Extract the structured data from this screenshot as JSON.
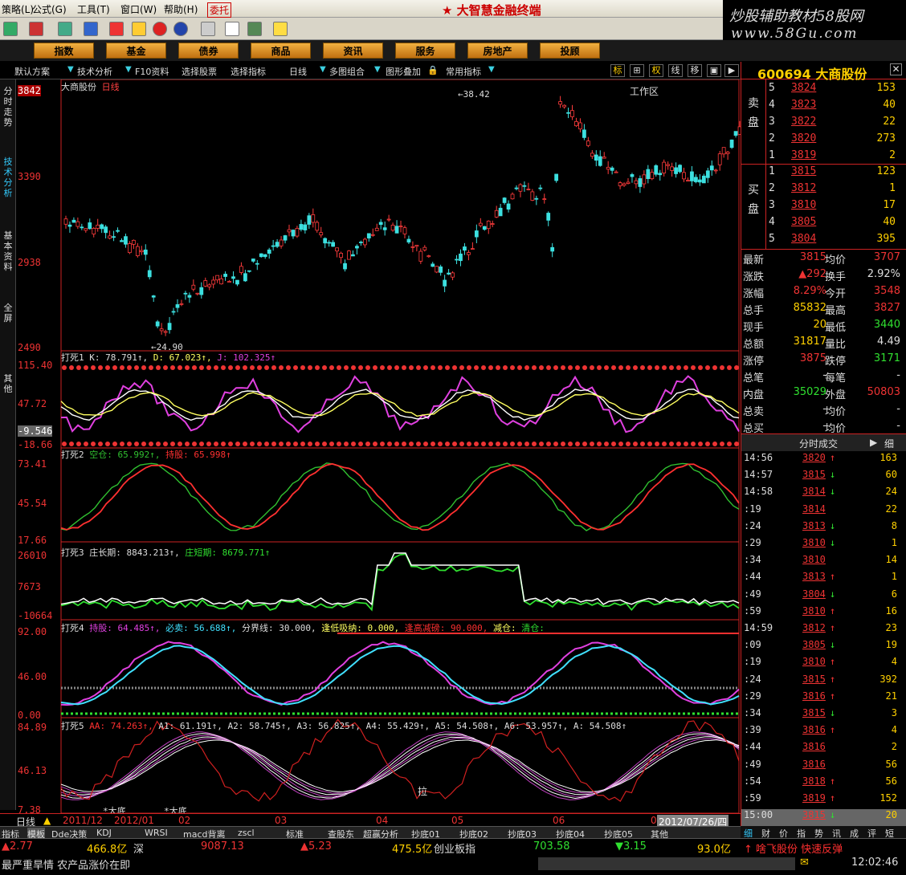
{
  "menu": {
    "items": [
      "策略(L)",
      "公式(G)",
      "工具(T)",
      "窗口(W)",
      "帮助(H)",
      "委托"
    ],
    "app_title": "大智慧金融终端"
  },
  "watermark": {
    "line1": "炒股辅助教材58股网",
    "line2": "www.58Gu.com"
  },
  "nav": {
    "buttons": [
      "指数",
      "基金",
      "债券",
      "商品",
      "资讯",
      "服务",
      "房地产",
      "投顾"
    ],
    "workarea": "工作区"
  },
  "subtoolbar": {
    "items": [
      "默认方案",
      "技术分析",
      "F10资料",
      "选择股票",
      "选择指标",
      "日线",
      "多图组合",
      "图形叠加",
      "常用指标"
    ],
    "right_buttons": [
      "标",
      "⊞",
      "权",
      "线",
      "移",
      "▣",
      "▶"
    ]
  },
  "left_tabs": [
    "分时走势",
    "技术分析",
    "基本资料",
    "全屏",
    "其他"
  ],
  "chart": {
    "title": "大商股份",
    "period": "日线",
    "high_label": "38.42",
    "low_label": "24.90",
    "axis_main": [
      "3842",
      "3390",
      "2938",
      "2490"
    ]
  },
  "panels": [
    {
      "id": "打死1",
      "axis": [
        "115.40",
        "47.72",
        "-9.546",
        "-18.66"
      ],
      "header": [
        {
          "t": "打死1 ",
          "c": "#ddd"
        },
        {
          "t": "K: 78.791↑,",
          "c": "#ddd"
        },
        {
          "t": " D: 67.023↑,",
          "c": "#ffff60"
        },
        {
          "t": " J: 102.325↑",
          "c": "#e040e0"
        }
      ]
    },
    {
      "id": "打死2",
      "axis": [
        "73.41",
        "45.54",
        "17.66"
      ],
      "header": [
        {
          "t": "打死2 ",
          "c": "#ddd"
        },
        {
          "t": "空仓: 65.992↑,",
          "c": "#30c030"
        },
        {
          "t": " 持股: 65.998↑",
          "c": "#ff3030"
        }
      ]
    },
    {
      "id": "打死3",
      "axis": [
        "26010",
        "7673",
        "-10664"
      ],
      "header": [
        {
          "t": "打死3 ",
          "c": "#ddd"
        },
        {
          "t": "庄长期: 8843.213↑,",
          "c": "#ddd"
        },
        {
          "t": " 庄短期: 8679.771↑",
          "c": "#30e030"
        }
      ]
    },
    {
      "id": "打死4",
      "axis": [
        "92.00",
        "46.00",
        "0.00"
      ],
      "header": [
        {
          "t": "打死4 ",
          "c": "#ddd"
        },
        {
          "t": "持股: 64.485↑,",
          "c": "#e040e0"
        },
        {
          "t": " 必卖: 56.688↑,",
          "c": "#40e0ff"
        },
        {
          "t": " 分界线: 30.000,",
          "c": "#ddd"
        },
        {
          "t": " 逢低吸纳: 0.000,",
          "c": "#ffff60"
        },
        {
          "t": " 逢高减磅: 90.000,",
          "c": "#ff3030"
        },
        {
          "t": " 减仓:",
          "c": "#ffff60"
        },
        {
          "t": " 清仓:",
          "c": "#30e030"
        }
      ]
    },
    {
      "id": "打死5",
      "axis": [
        "84.89",
        "46.13",
        "7.38"
      ],
      "header": [
        {
          "t": "打死5 ",
          "c": "#ddd"
        },
        {
          "t": "AA: 74.263↑,",
          "c": "#ff3030"
        },
        {
          "t": " A1: 61.191↑,",
          "c": "#ddd"
        },
        {
          "t": " A2: 58.745↑,",
          "c": "#ddd"
        },
        {
          "t": " A3: 56.825↑,",
          "c": "#ddd"
        },
        {
          "t": " A4: 55.429↑,",
          "c": "#ddd"
        },
        {
          "t": " A5: 54.508↑,",
          "c": "#ddd"
        },
        {
          "t": " A6: 53.957↑,",
          "c": "#ddd"
        },
        {
          "t": " A: 54.508↑",
          "c": "#ddd"
        }
      ]
    }
  ],
  "xaxis": {
    "period_label": "日线",
    "labels": [
      "2011/12",
      "2012/01",
      "02",
      "03",
      "04",
      "05",
      "06",
      "07"
    ],
    "date_box": "2012/07/26/四"
  },
  "tabs": [
    "指标",
    "模板",
    "Dde决策",
    "KDJ",
    "WRSI",
    "macd背离",
    "zscl",
    "标准",
    "查股东",
    "超赢分析",
    "抄底01",
    "抄底02",
    "抄底03",
    "抄底04",
    "抄底05",
    "其他"
  ],
  "pattern_text": {
    "pull": "拉",
    "bottom1": "*大底",
    "bottom2": "*大底"
  },
  "status": {
    "row1": [
      {
        "t": "▲2.77",
        "c": "#e33"
      },
      {
        "t": "466.8亿",
        "c": "#ffd000"
      },
      {
        "t": "深",
        "c": "#ddd"
      },
      {
        "t": "9087.13",
        "c": "#e33"
      },
      {
        "t": "▲5.23",
        "c": "#e33"
      },
      {
        "t": "475.5亿",
        "c": "#ffd000"
      },
      {
        "t": "创业板指",
        "c": "#ddd"
      },
      {
        "t": "703.58",
        "c": "#30e030"
      },
      {
        "t": "▼3.15",
        "c": "#30e030"
      },
      {
        "t": "93.0亿",
        "c": "#ffd000"
      },
      {
        "t": "↑ 啥飞股份 快速反弹",
        "c": "#ff3030"
      }
    ],
    "news": "最严重旱情 农产品涨价在即",
    "time": "12:02:46"
  },
  "stock": {
    "code": "600694",
    "name": "大商股份"
  },
  "orderbook": {
    "sell_label": "卖盘",
    "buy_label": "买盘",
    "sells": [
      {
        "l": "5",
        "p": "3824",
        "v": "153"
      },
      {
        "l": "4",
        "p": "3823",
        "v": "40"
      },
      {
        "l": "3",
        "p": "3822",
        "v": "22"
      },
      {
        "l": "2",
        "p": "3820",
        "v": "273"
      },
      {
        "l": "1",
        "p": "3819",
        "v": "2"
      }
    ],
    "buys": [
      {
        "l": "1",
        "p": "3815",
        "v": "123"
      },
      {
        "l": "2",
        "p": "3812",
        "v": "1"
      },
      {
        "l": "3",
        "p": "3810",
        "v": "17"
      },
      {
        "l": "4",
        "p": "3805",
        "v": "40"
      },
      {
        "l": "5",
        "p": "3804",
        "v": "395"
      }
    ]
  },
  "quote": [
    {
      "a": "最新",
      "av": "3815",
      "ac": "#e33",
      "b": "均价",
      "bv": "3707",
      "bc": "#e33"
    },
    {
      "a": "涨跌",
      "av": "▲292",
      "ac": "#e33",
      "b": "换手",
      "bv": "2.92%",
      "bc": "#ddd"
    },
    {
      "a": "涨幅",
      "av": "8.29%",
      "ac": "#e33",
      "b": "今开",
      "bv": "3548",
      "bc": "#e33"
    },
    {
      "a": "总手",
      "av": "85832",
      "ac": "#ffd000",
      "b": "最高",
      "bv": "3827",
      "bc": "#e33"
    },
    {
      "a": "现手",
      "av": "20",
      "ac": "#ffd000",
      "b": "最低",
      "bv": "3440",
      "bc": "#30e030"
    },
    {
      "a": "总额",
      "av": "31817",
      "ac": "#ffd000",
      "b": "量比",
      "bv": "4.49",
      "bc": "#ddd"
    },
    {
      "a": "涨停",
      "av": "3875",
      "ac": "#e33",
      "b": "跌停",
      "bv": "3171",
      "bc": "#30e030"
    },
    {
      "a": "总笔",
      "av": "-",
      "ac": "#ddd",
      "b": "每笔",
      "bv": "-",
      "bc": "#ddd"
    },
    {
      "a": "内盘",
      "av": "35029",
      "ac": "#30e030",
      "b": "外盘",
      "bv": "50803",
      "bc": "#e33"
    },
    {
      "a": "总卖",
      "av": "-",
      "ac": "#ddd",
      "b": "均价",
      "bv": "-",
      "bc": "#ddd"
    },
    {
      "a": "总买",
      "av": "-",
      "ac": "#ddd",
      "b": "均价",
      "bv": "-",
      "bc": "#ddd"
    }
  ],
  "trades_header": "分时成交",
  "trades_more": "细",
  "trades": [
    {
      "t": "14:56",
      "p": "3820",
      "d": "up",
      "v": "163"
    },
    {
      "t": "14:57",
      "p": "3815",
      "d": "dn",
      "v": "60"
    },
    {
      "t": "14:58",
      "p": "3814",
      "d": "dn",
      "v": "24"
    },
    {
      "t": ":19",
      "p": "3814",
      "d": "",
      "v": "22"
    },
    {
      "t": ":24",
      "p": "3813",
      "d": "dn",
      "v": "8"
    },
    {
      "t": ":29",
      "p": "3810",
      "d": "dn",
      "v": "1"
    },
    {
      "t": ":34",
      "p": "3810",
      "d": "",
      "v": "14"
    },
    {
      "t": ":44",
      "p": "3813",
      "d": "up",
      "v": "1"
    },
    {
      "t": ":49",
      "p": "3804",
      "d": "dn",
      "v": "6"
    },
    {
      "t": ":59",
      "p": "3810",
      "d": "up",
      "v": "16"
    },
    {
      "t": "14:59",
      "p": "3812",
      "d": "up",
      "v": "23"
    },
    {
      "t": ":09",
      "p": "3805",
      "d": "dn",
      "v": "19"
    },
    {
      "t": ":19",
      "p": "3810",
      "d": "up",
      "v": "4"
    },
    {
      "t": ":24",
      "p": "3815",
      "d": "up",
      "v": "392"
    },
    {
      "t": ":29",
      "p": "3816",
      "d": "up",
      "v": "21"
    },
    {
      "t": ":34",
      "p": "3815",
      "d": "dn",
      "v": "3"
    },
    {
      "t": ":39",
      "p": "3816",
      "d": "up",
      "v": "4"
    },
    {
      "t": ":44",
      "p": "3816",
      "d": "",
      "v": "2"
    },
    {
      "t": ":49",
      "p": "3816",
      "d": "",
      "v": "56"
    },
    {
      "t": ":54",
      "p": "3818",
      "d": "up",
      "v": "56"
    },
    {
      "t": ":59",
      "p": "3819",
      "d": "up",
      "v": "152"
    },
    {
      "t": "15:00",
      "p": "3815",
      "d": "dn",
      "v": "20"
    }
  ],
  "rtabs": [
    "细",
    "财",
    "价",
    "指",
    "势",
    "讯",
    "成",
    "评",
    "短"
  ]
}
